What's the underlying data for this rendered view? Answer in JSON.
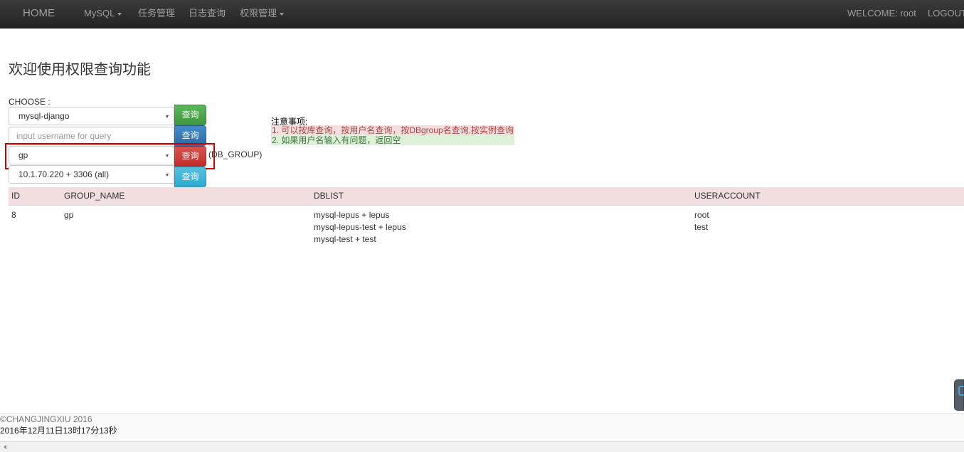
{
  "navbar": {
    "brand": "HOME",
    "items": [
      "MySQL",
      "任务管理",
      "日志查询",
      "权限管理"
    ],
    "welcome": "WELCOME: root",
    "logout": "LOGOUT"
  },
  "page": {
    "title": "欢迎使用权限查询功能",
    "choose_label": "CHOOSE :"
  },
  "form": {
    "instance_select": "mysql-django",
    "username_placeholder": "input username for query",
    "dbgroup_select": "gp",
    "dbgroup_suffix": "(DB_GROUP)",
    "instance_port_select": "10.1.70.220 + 3306 (all)",
    "query_label": "查询"
  },
  "notes": {
    "title": "注意事项:",
    "items": [
      "1. 可以按库查询，按用户名查询，按DBgroup名查询,按实例查询",
      "2. 如果用户名输入有问题，返回空"
    ]
  },
  "table": {
    "headers": [
      "ID",
      "GROUP_NAME",
      "DBLIST",
      "USERACCOUNT"
    ],
    "rows": [
      {
        "id": "8",
        "group_name": "gp",
        "dblist": [
          "mysql-lepus + lepus",
          "mysql-lepus-test + lepus",
          "mysql-test + test"
        ],
        "useraccount": [
          "root",
          "test"
        ]
      }
    ]
  },
  "footer": {
    "copyright": "©CHANGJINGXIU 2016",
    "datetime": "2016年12月11日13时17分13秒"
  },
  "colors": {
    "navbar": "#222222",
    "table_header": "#f2dede",
    "note_error_bg": "#f2dede",
    "note_success_bg": "#dff0d8",
    "highlight_border": "#cc0000"
  }
}
